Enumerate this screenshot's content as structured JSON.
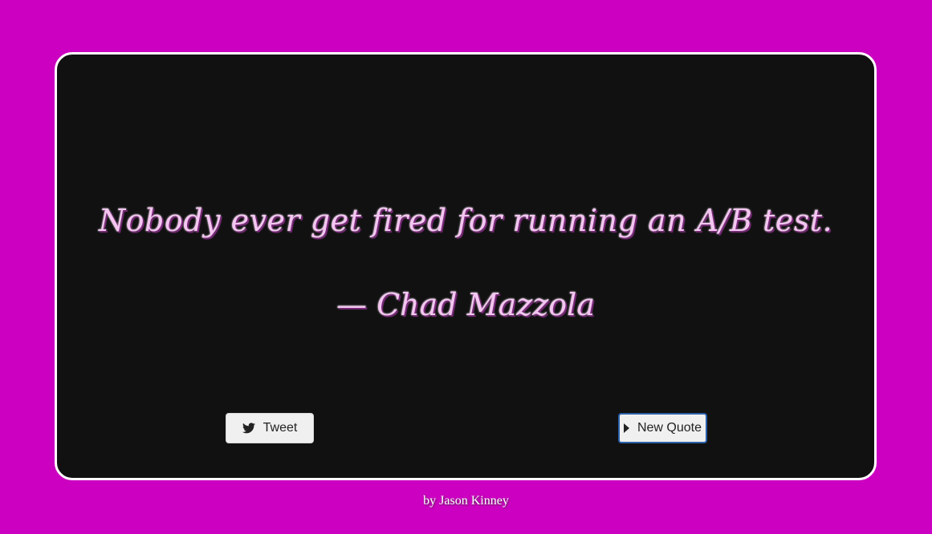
{
  "colors": {
    "background": "#cc00c0",
    "card": "#111111",
    "quote_text": "#f3c6f0"
  },
  "quote": {
    "text": "Nobody ever get fired for running an A/B test.",
    "author": "— Chad Mazzola"
  },
  "buttons": {
    "tweet_label": "Tweet",
    "tweet_icon": "twitter-icon",
    "new_quote_label": "New Quote",
    "new_quote_icon": "caret-right-icon"
  },
  "footer": {
    "credit": "by Jason Kinney"
  }
}
